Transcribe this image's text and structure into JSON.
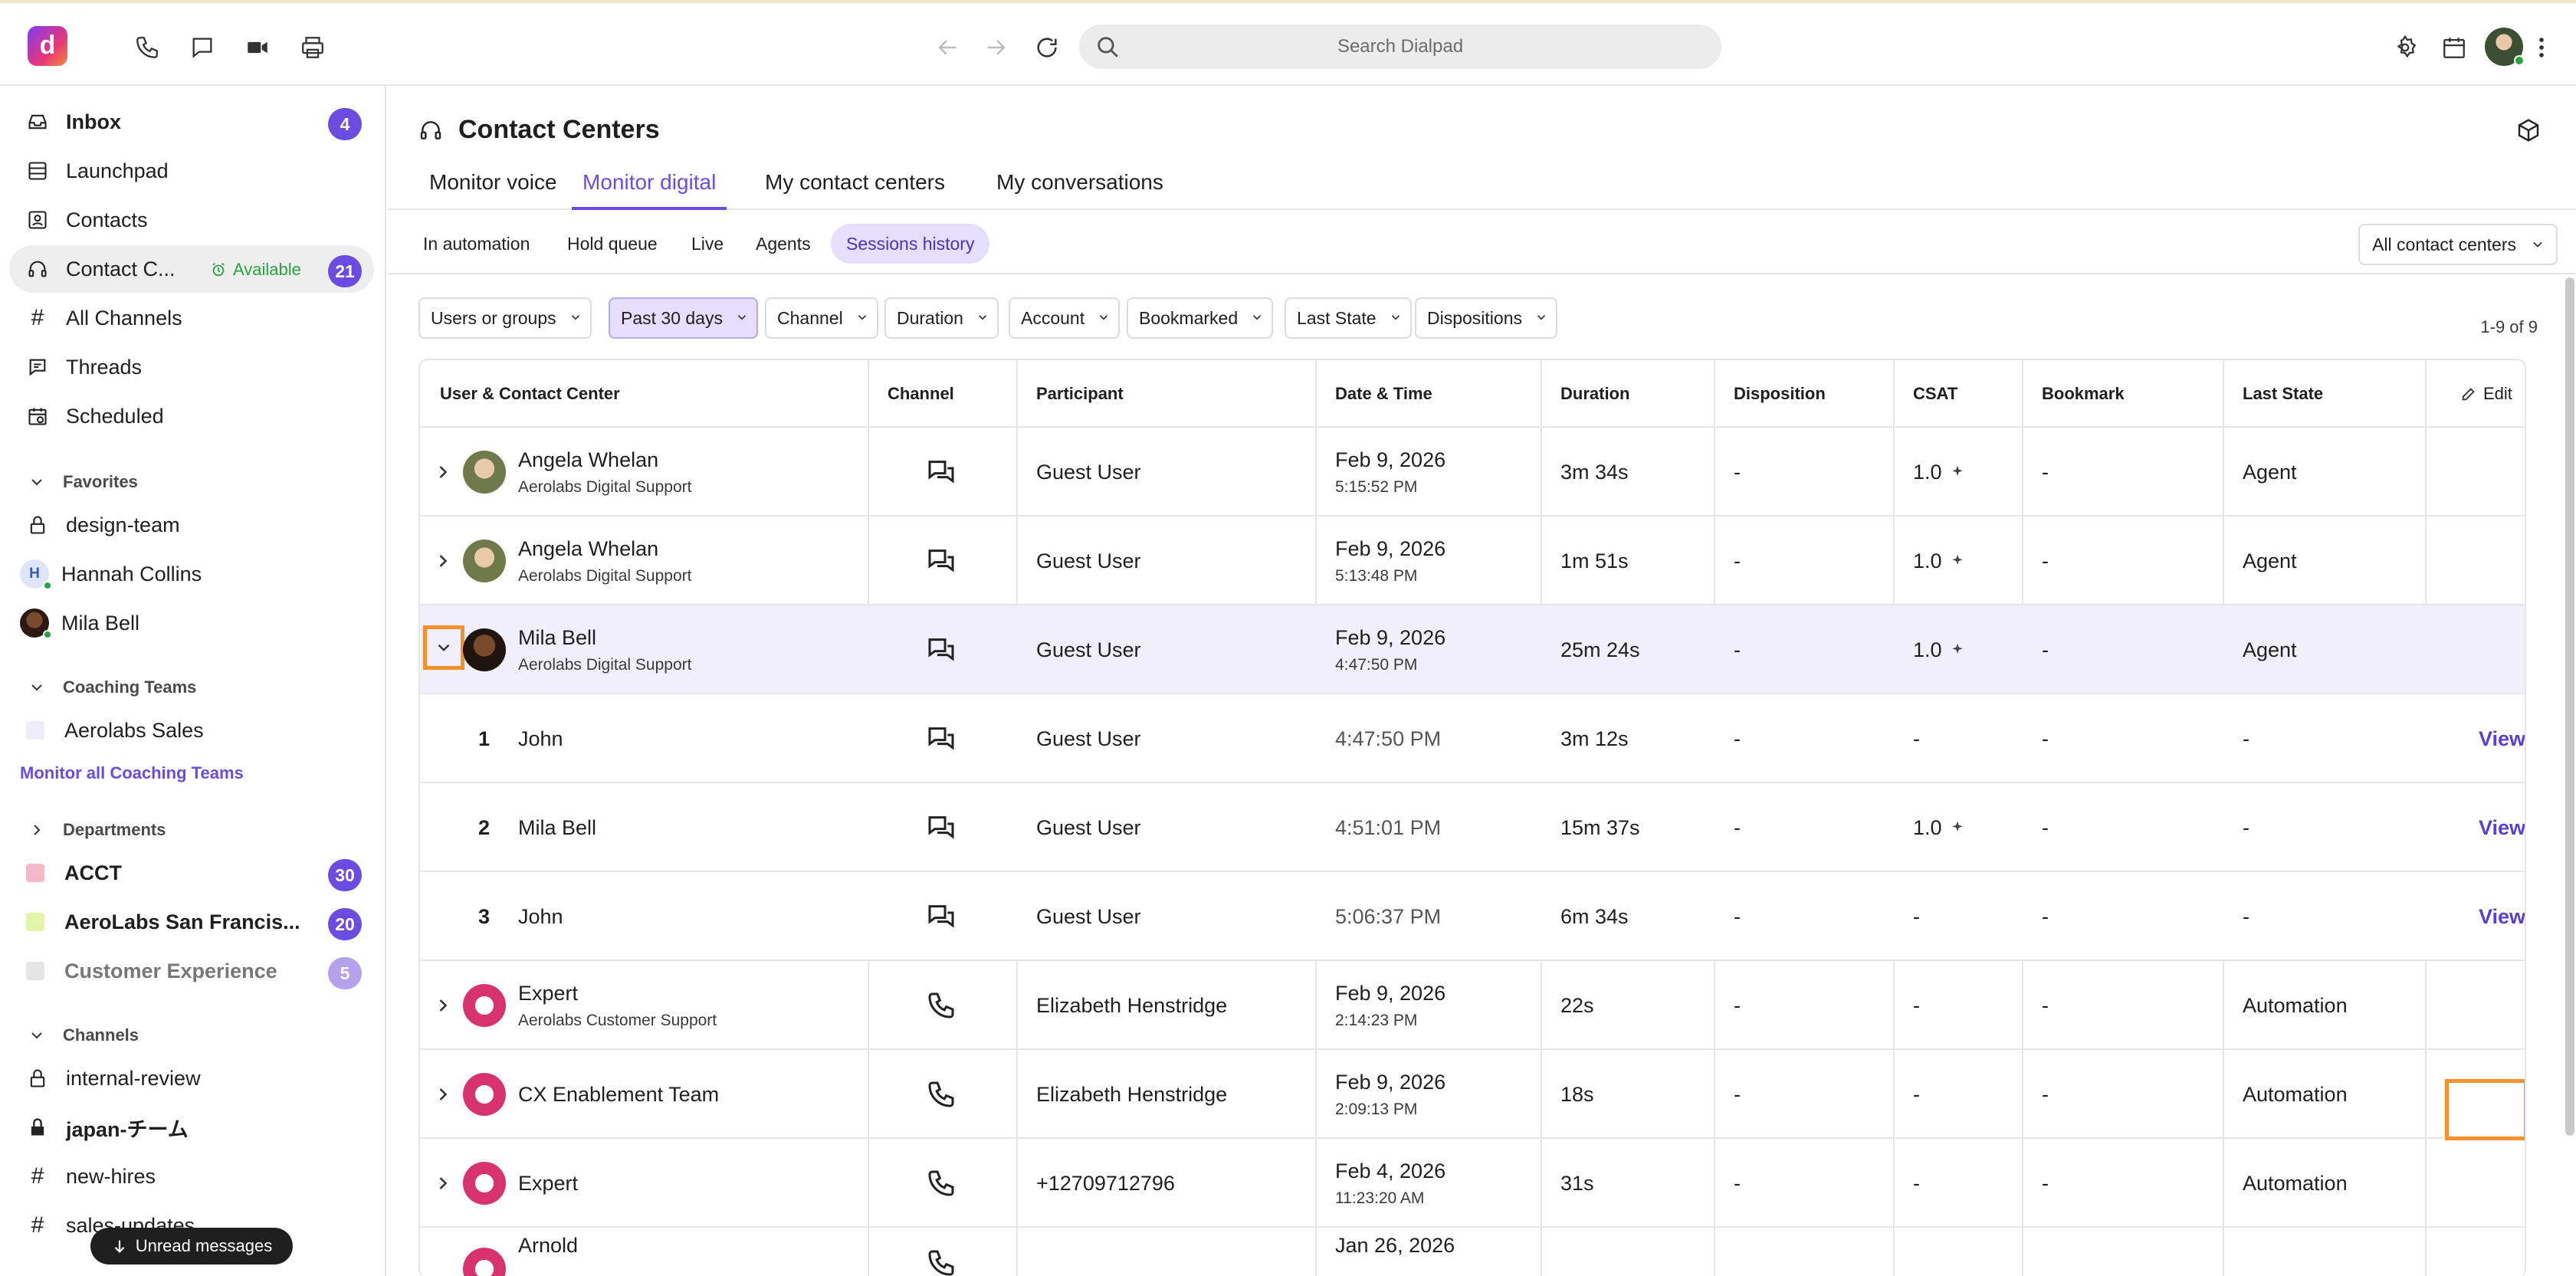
{
  "topbar": {
    "logo": "d",
    "search_placeholder": "Search Dialpad",
    "icons": [
      "phone-icon",
      "chat-icon",
      "video-icon",
      "print-icon",
      "back-icon",
      "forward-icon",
      "refresh-icon",
      "search-icon",
      "settings-icon",
      "calendar-icon",
      "more-icon"
    ]
  },
  "sidebar": {
    "items": [
      {
        "label": "Inbox",
        "badge": "4"
      },
      {
        "label": "Launchpad"
      },
      {
        "label": "Contacts"
      },
      {
        "label": "Contact C...",
        "status": "Available",
        "badge": "21"
      },
      {
        "label": "All Channels"
      },
      {
        "label": "Threads"
      },
      {
        "label": "Scheduled"
      }
    ],
    "favorites": {
      "heading": "Favorites",
      "items": [
        {
          "label": "design-team"
        },
        {
          "label": "Hannah Collins",
          "initial": "H"
        },
        {
          "label": "Mila Bell"
        }
      ]
    },
    "coaching": {
      "heading": "Coaching Teams",
      "items": [
        {
          "label": "Aerolabs Sales"
        }
      ],
      "monitor_link": "Monitor all Coaching Teams"
    },
    "departments": {
      "heading": "Departments",
      "items": [
        {
          "label": "ACCT",
          "badge": "30",
          "color": "#f5b8c8"
        },
        {
          "label": "AeroLabs San Francis...",
          "badge": "20",
          "color": "#e3f5a8"
        },
        {
          "label": "Customer Experience",
          "badge": "5",
          "color": "#e5e5e5"
        }
      ]
    },
    "channels": {
      "heading": "Channels",
      "items": [
        {
          "label": "internal-review"
        },
        {
          "label": "japan-チーム"
        },
        {
          "label": "new-hires"
        },
        {
          "label": "sales-updates"
        }
      ]
    },
    "unread_label": "Unread messages"
  },
  "main": {
    "title": "Contact Centers",
    "tabs": [
      "Monitor voice",
      "Monitor digital",
      "My contact centers",
      "My conversations"
    ],
    "active_tab": "Monitor digital",
    "subtabs": [
      "In automation",
      "Hold queue",
      "Live",
      "Agents",
      "Sessions history"
    ],
    "active_subtab": "Sessions history",
    "center_filter": "All contact centers",
    "filters": [
      "Users or groups",
      "Past 30 days",
      "Channel",
      "Duration",
      "Account",
      "Bookmarked",
      "Last State",
      "Dispositions"
    ],
    "count": "1-9 of 9",
    "columns": [
      "User & Contact Center",
      "Channel",
      "Participant",
      "Date & Time",
      "Duration",
      "Disposition",
      "CSAT",
      "Bookmark",
      "Last State"
    ],
    "edit_label": "Edit",
    "rows": [
      {
        "name": "Angela Whelan",
        "center": "Aerolabs Digital Support",
        "channel": "digital",
        "participant": "Guest User",
        "date": "Feb 9, 2026",
        "time": "5:15:52 PM",
        "duration": "3m 34s",
        "disposition": "-",
        "csat": "1.0",
        "bookmark": "-",
        "state": "Agent"
      },
      {
        "name": "Angela Whelan",
        "center": "Aerolabs Digital Support",
        "channel": "digital",
        "participant": "Guest User",
        "date": "Feb 9, 2026",
        "time": "5:13:48 PM",
        "duration": "1m 51s",
        "disposition": "-",
        "csat": "1.0",
        "bookmark": "-",
        "state": "Agent"
      },
      {
        "name": "Mila Bell",
        "center": "Aerolabs Digital Support",
        "channel": "digital",
        "participant": "Guest User",
        "date": "Feb 9, 2026",
        "time": "4:47:50 PM",
        "duration": "25m 24s",
        "disposition": "-",
        "csat": "1.0",
        "bookmark": "-",
        "state": "Agent"
      }
    ],
    "child_rows": [
      {
        "num": "1",
        "name": "John",
        "participant": "Guest User",
        "time": "4:47:50 PM",
        "duration": "3m 12s",
        "disposition": "-",
        "csat": "-",
        "bookmark": "-",
        "state": "-",
        "action": "View"
      },
      {
        "num": "2",
        "name": "Mila Bell",
        "participant": "Guest User",
        "time": "4:51:01 PM",
        "duration": "15m 37s",
        "disposition": "-",
        "csat": "1.0",
        "bookmark": "-",
        "state": "-",
        "action": "View"
      },
      {
        "num": "3",
        "name": "John",
        "participant": "Guest User",
        "time": "5:06:37 PM",
        "duration": "6m 34s",
        "disposition": "-",
        "csat": "-",
        "bookmark": "-",
        "state": "-",
        "action": "View"
      }
    ],
    "rows2": [
      {
        "name": "Expert",
        "center": "Aerolabs Customer Support",
        "participant": "Elizabeth Henstridge",
        "date": "Feb 9, 2026",
        "time": "2:14:23 PM",
        "duration": "22s",
        "disposition": "-",
        "csat": "-",
        "bookmark": "-",
        "state": "Automation"
      },
      {
        "name": "CX Enablement Team",
        "center": "",
        "participant": "Elizabeth Henstridge",
        "date": "Feb 9, 2026",
        "time": "2:09:13 PM",
        "duration": "18s",
        "disposition": "-",
        "csat": "-",
        "bookmark": "-",
        "state": "Automation"
      },
      {
        "name": "Expert",
        "center": "",
        "participant": "+12709712796",
        "date": "Feb 4, 2026",
        "time": "11:23:20 AM",
        "duration": "31s",
        "disposition": "-",
        "csat": "-",
        "bookmark": "-",
        "state": "Automation"
      },
      {
        "name": "Arnold",
        "center": "",
        "participant": "",
        "date": "Jan 26, 2026",
        "time": "",
        "duration": "",
        "disposition": "",
        "csat": "",
        "bookmark": "",
        "state": ""
      }
    ]
  }
}
